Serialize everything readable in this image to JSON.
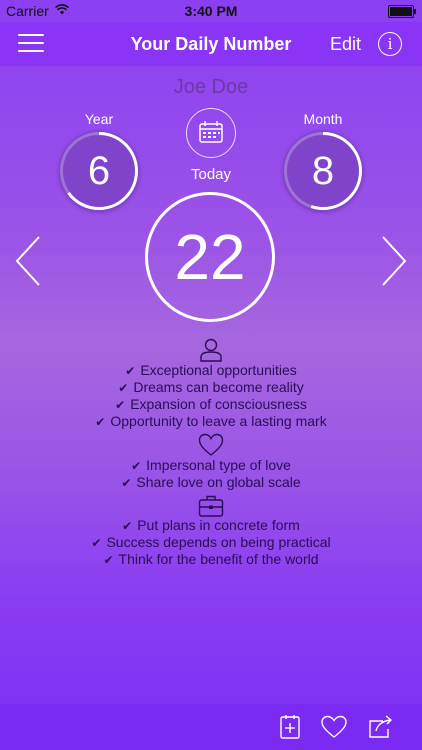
{
  "status_bar": {
    "carrier": "Carrier",
    "time": "3:40 PM"
  },
  "nav": {
    "title": "Your Daily Number",
    "edit_label": "Edit",
    "info_label": "i"
  },
  "profile": {
    "name": "Joe Doe"
  },
  "year": {
    "label": "Year",
    "value": "6",
    "progress": 0.65
  },
  "month": {
    "label": "Month",
    "value": "8",
    "progress": 0.55
  },
  "today": {
    "label": "Today",
    "value": "22"
  },
  "sections": {
    "personal": {
      "icon": "person-icon",
      "items": [
        "Exceptional opportunities",
        "Dreams can become reality",
        "Expansion of consciousness",
        "Opportunity to leave a lasting mark"
      ]
    },
    "love": {
      "icon": "heart-icon",
      "items": [
        "Impersonal type of love",
        "Share love on global scale"
      ]
    },
    "work": {
      "icon": "briefcase-icon",
      "items": [
        "Put plans in concrete form",
        "Success depends on being practical",
        "Think for the benefit of the world"
      ]
    }
  },
  "check_mark": "✔",
  "colors": {
    "nav_bg": "#8a35f6",
    "text_dark": "#2a0d57",
    "ring_fill": "#7f44c9"
  }
}
